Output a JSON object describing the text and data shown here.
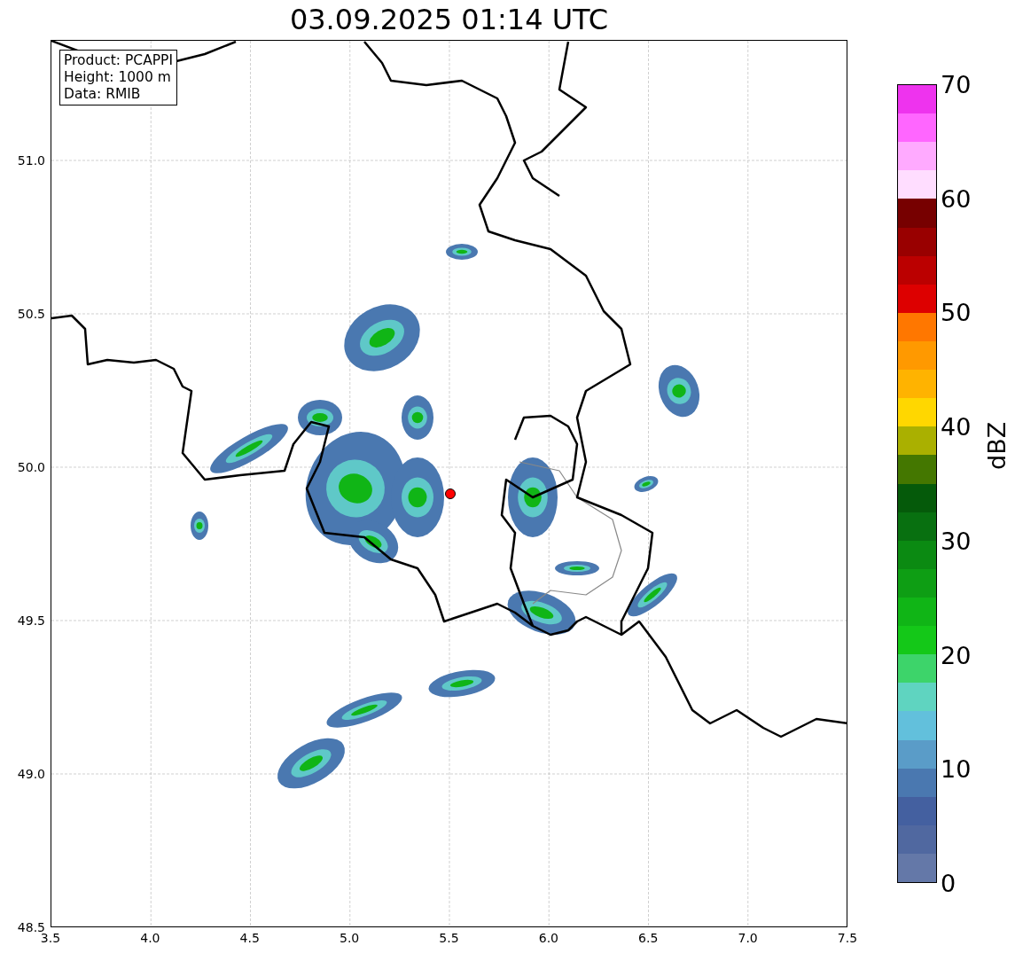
{
  "title": "03.09.2025 01:14 UTC",
  "info_box": {
    "lines": [
      "Product: PCAPPI",
      "Height: 1000 m",
      "Data: RMIB"
    ]
  },
  "map": {
    "x_ticks": [
      "3.5",
      "4.0",
      "4.5",
      "5.0",
      "5.5",
      "6.0",
      "6.5",
      "7.0",
      "7.5"
    ],
    "y_ticks": [
      "51.0",
      "50.5",
      "50.0",
      "49.5",
      "49.0",
      "48.5"
    ]
  },
  "colorbar": {
    "label": "dBZ",
    "ticks": [
      "70",
      "60",
      "50",
      "40",
      "30",
      "20",
      "10",
      "0"
    ],
    "segments": [
      {
        "color": "#ee33ee"
      },
      {
        "color": "#ff66ff"
      },
      {
        "color": "#ffaaff"
      },
      {
        "color": "#ffddff"
      },
      {
        "color": "#770000"
      },
      {
        "color": "#990000"
      },
      {
        "color": "#bb0000"
      },
      {
        "color": "#dd0000"
      },
      {
        "color": "#ff7700"
      },
      {
        "color": "#ff9900"
      },
      {
        "color": "#ffb300"
      },
      {
        "color": "#ffd700"
      },
      {
        "color": "#aab000"
      },
      {
        "color": "#447700"
      },
      {
        "color": "#055a0a"
      },
      {
        "color": "#087010"
      },
      {
        "color": "#0b8a12"
      },
      {
        "color": "#0e9e14"
      },
      {
        "color": "#10b516"
      },
      {
        "color": "#14c818"
      },
      {
        "color": "#3dd46a"
      },
      {
        "color": "#5fd4c0"
      },
      {
        "color": "#62c0dc"
      },
      {
        "color": "#5a9cc8"
      },
      {
        "color": "#4a78b0"
      },
      {
        "color": "#4460a0"
      },
      {
        "color": "#5068a0"
      },
      {
        "color": "#6478a8"
      }
    ]
  }
}
